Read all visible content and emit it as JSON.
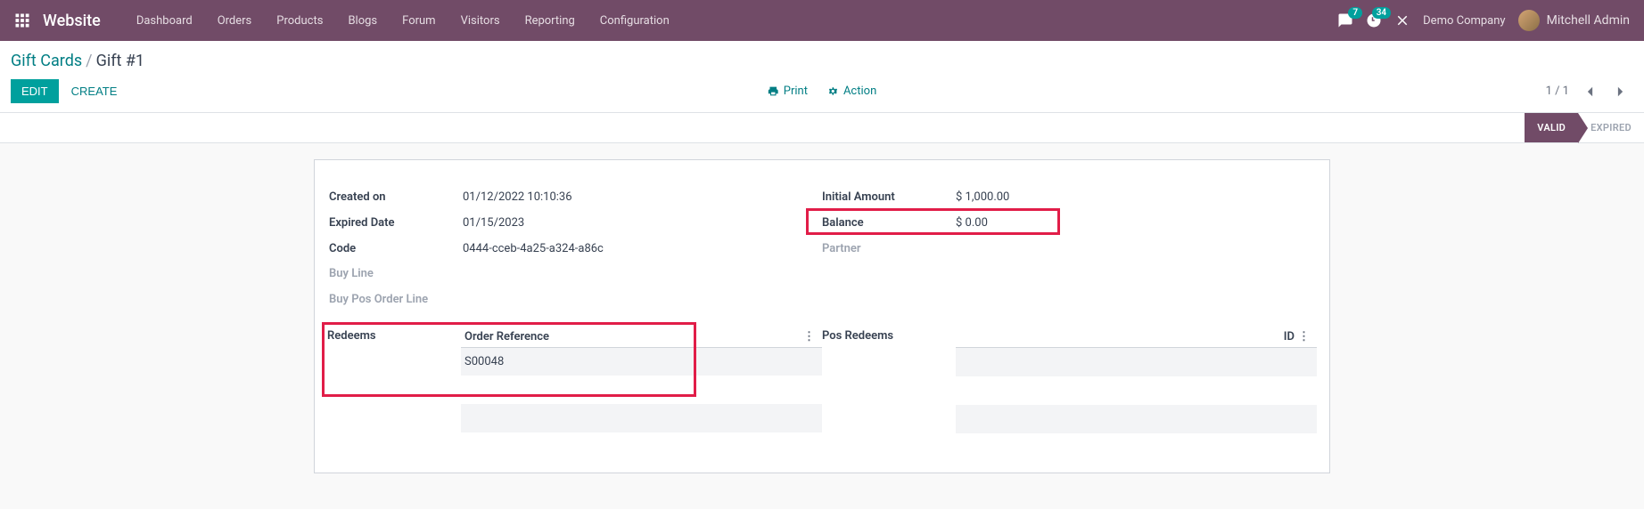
{
  "nav": {
    "brand": "Website",
    "items": [
      "Dashboard",
      "Orders",
      "Products",
      "Blogs",
      "Forum",
      "Visitors",
      "Reporting",
      "Configuration"
    ],
    "msg_badge": "7",
    "clock_badge": "34",
    "company": "Demo Company",
    "user": "Mitchell Admin"
  },
  "breadcrumb": {
    "parent": "Gift Cards",
    "current": "Gift #1"
  },
  "actions": {
    "edit": "EDIT",
    "create": "CREATE",
    "print": "Print",
    "action": "Action",
    "pager": "1 / 1"
  },
  "status": {
    "valid": "VALID",
    "expired": "EXPIRED"
  },
  "form": {
    "left": {
      "created_on_label": "Created on",
      "created_on": "01/12/2022 10:10:36",
      "expired_label": "Expired Date",
      "expired": "01/15/2023",
      "code_label": "Code",
      "code": "0444-cceb-4a25-a324-a86c",
      "buy_line_label": "Buy Line",
      "buy_pos_label": "Buy Pos Order Line"
    },
    "right": {
      "initial_label": "Initial Amount",
      "initial": "$ 1,000.00",
      "balance_label": "Balance",
      "balance": "$ 0.00",
      "partner_label": "Partner"
    }
  },
  "panels": {
    "redeems_label": "Redeems",
    "redeems_col": "Order Reference",
    "redeems_rows": [
      "S00048"
    ],
    "pos_redeems_label": "Pos Redeems",
    "pos_redeems_col": "ID"
  }
}
